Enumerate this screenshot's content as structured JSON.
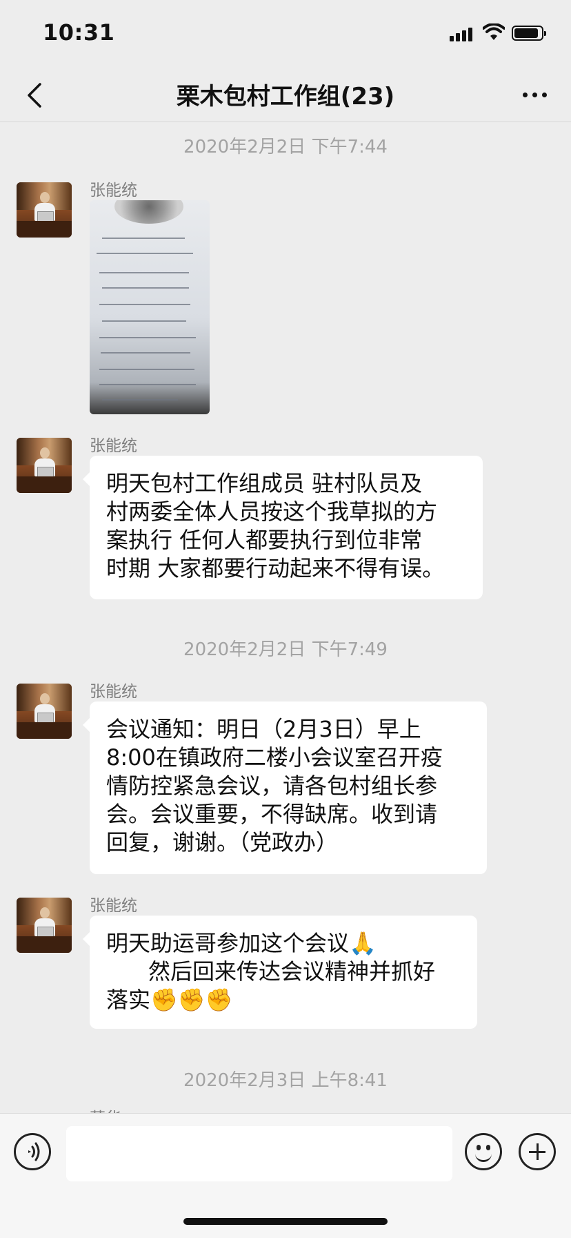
{
  "status_bar": {
    "time": "10:31"
  },
  "nav": {
    "title": "栗木包村工作组(23)"
  },
  "timestamps": [
    "2020年2月2日 下午7:44",
    "2020年2月2日 下午7:49",
    "2020年2月3日 上午8:41"
  ],
  "messages": [
    {
      "sender": "张能统",
      "type": "image"
    },
    {
      "sender": "张能统",
      "type": "text",
      "text": "明天包村工作组成员 驻村队员及\n村两委全体人员按这个我草拟的方\n案执行 任何人都要执行到位非常\n时期 大家都要行动起来不得有误。"
    },
    {
      "sender": "张能统",
      "type": "text",
      "text": "会议通知：明日（2月3日）早上\n8:00在镇政府二楼小会议室召开疫\n情防控紧急会议，请各包村组长参\n会。会议重要，不得缺席。收到请\n回复，谢谢。（党政办）"
    },
    {
      "sender": "张能统",
      "type": "text",
      "text": "明天助运哥参加这个会议🙏\n      然后回来传达会议精神并抓好\n落实✊✊✊"
    }
  ],
  "partial_sender": "莫华",
  "icons": {
    "back": "chevron-left-icon",
    "more": "ellipsis-icon",
    "voice": "voice-icon",
    "emoji": "smiley-icon",
    "plus": "plus-icon"
  },
  "colors": {
    "background": "#ededed",
    "bubble": "#ffffff",
    "timestamp": "#a3a3a3"
  }
}
